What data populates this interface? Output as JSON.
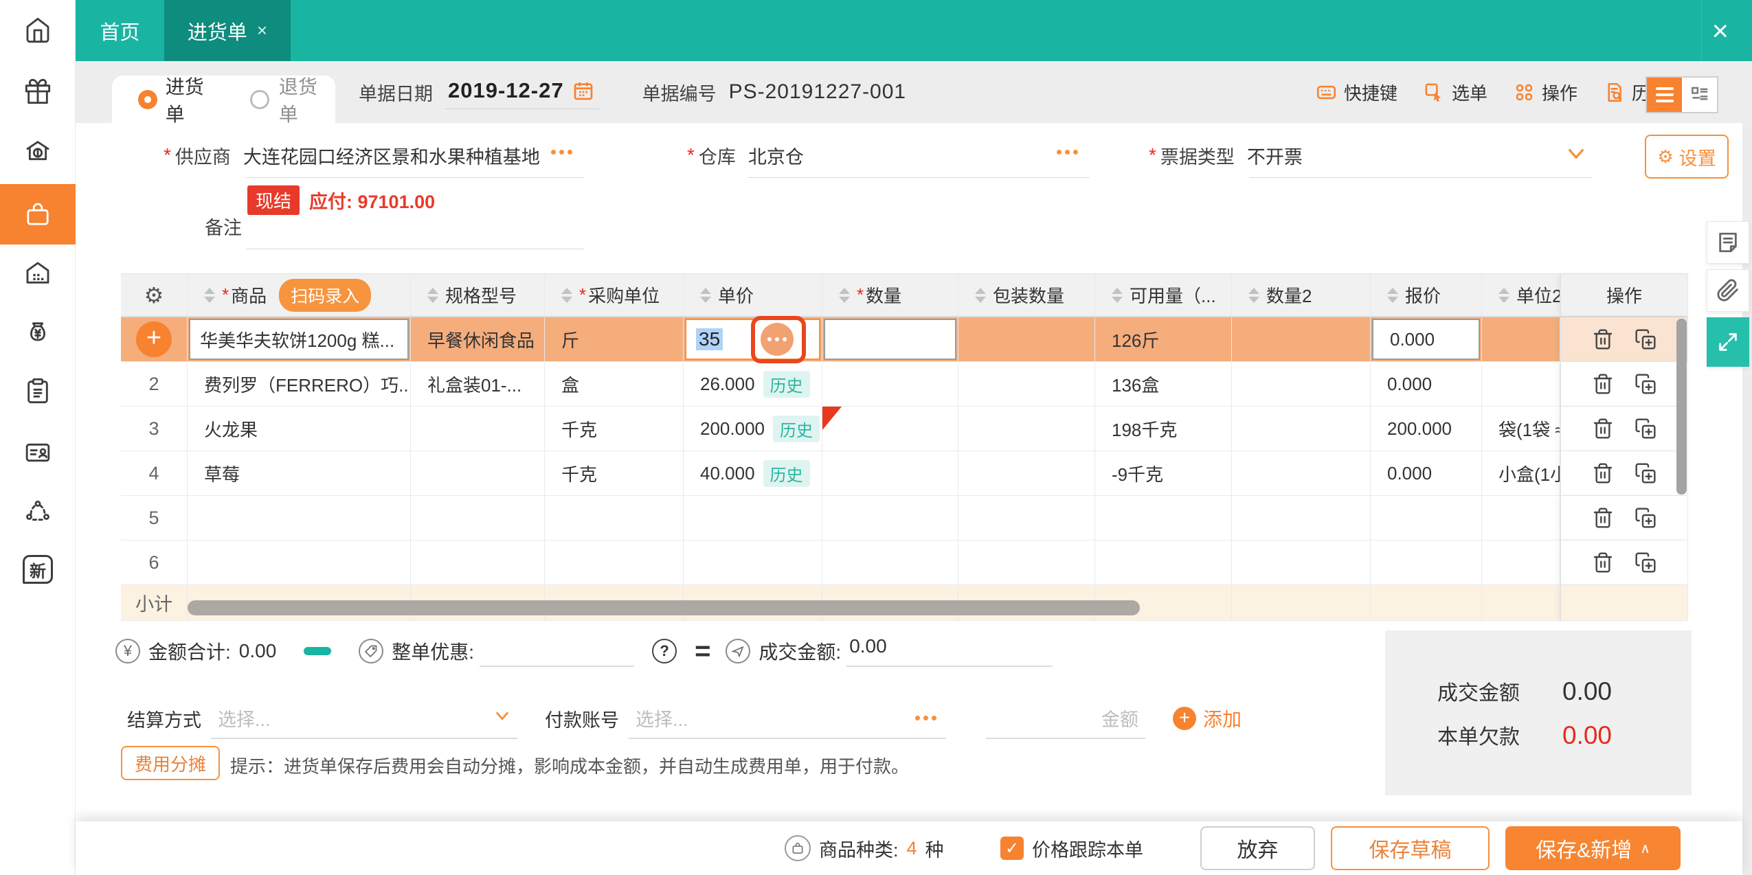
{
  "topbar": {
    "home_tab": "首页",
    "active_tab": "进货单",
    "close_tab": "×",
    "close_window": "×"
  },
  "sidebar": {
    "items": [
      "home",
      "gift",
      "sales",
      "purchase",
      "warehouse",
      "funds",
      "orders",
      "contacts",
      "share",
      "new"
    ],
    "new_label": "新"
  },
  "doc": {
    "type_purchase": "进货单",
    "type_return": "退货单",
    "date_label": "单据日期",
    "date_value": "2019-12-27",
    "number_label": "单据编号",
    "number_value": "PS-20191227-001"
  },
  "tools": {
    "shortcut": "快捷键",
    "pick": "选单",
    "operate": "操作",
    "history": "历史单据"
  },
  "form": {
    "required_mark": "*",
    "supplier_label": "供应商",
    "supplier_value": "大连花园口经济区景和水果种植基地",
    "settle_badge": "现结",
    "payable_text": "应付: 97101.00",
    "remark_label": "备注",
    "warehouse_label": "仓库",
    "warehouse_value": "北京仓",
    "bill_label": "票据类型",
    "bill_value": "不开票",
    "settings_label": "设置"
  },
  "table": {
    "scan_button": "扫码录入",
    "headers": [
      "",
      "商品",
      "规格型号",
      "采购单位",
      "单价",
      "数量",
      "包装数量",
      "可用量（...",
      "数量2",
      "报价",
      "单位2",
      "操作"
    ],
    "required_cols": [
      1,
      3,
      5
    ],
    "history_badge": "历史",
    "rows": [
      {
        "index": "+",
        "selected": true,
        "product": "华美华夫软饼1200g 糕...",
        "spec": "早餐休闲食品",
        "unit": "斤",
        "price": "35",
        "qty": "",
        "pack": "",
        "available": "126斤",
        "qty2": "",
        "quote": "0.000",
        "unit2": ""
      },
      {
        "index": "2",
        "product": "费列罗（FERRERO）巧...",
        "spec": "礼盒装01-...",
        "unit": "盒",
        "price": "26.000",
        "history": true,
        "available": "136盒",
        "quote": "0.000",
        "unit2": ""
      },
      {
        "index": "3",
        "product": "火龙果",
        "spec": "",
        "unit": "千克",
        "price": "200.000",
        "history": true,
        "flag": true,
        "available": "198千克",
        "quote": "200.000",
        "unit2": "袋(1袋 ≈"
      },
      {
        "index": "4",
        "product": "草莓",
        "spec": "",
        "unit": "千克",
        "price": "40.000",
        "history": true,
        "available": "-9千克",
        "quote": "0.000",
        "unit2": "小盒(1小"
      },
      {
        "index": "5"
      },
      {
        "index": "6"
      },
      {
        "index": "小计",
        "subtotal": true
      }
    ]
  },
  "totals": {
    "sum_label": "金额合计:",
    "sum_value": "0.00",
    "discount_label": "整单优惠:",
    "deal_label": "成交金额:",
    "deal_value": "0.00"
  },
  "payment": {
    "method_label": "结算方式",
    "method_placeholder": "选择...",
    "account_label": "付款账号",
    "account_placeholder": "选择...",
    "amount_placeholder": "金额",
    "add_label": "添加"
  },
  "fee": {
    "button_label": "费用分摊",
    "tip": "提示：进货单保存后费用会自动分摊，影响成本金额，并自动生成费用单，用于付款。"
  },
  "summary": {
    "deal_label": "成交金额",
    "deal_value": "0.00",
    "debt_label": "本单欠款",
    "debt_value": "0.00"
  },
  "footer": {
    "category_label": "商品种类:",
    "category_count": "4",
    "category_unit": "种",
    "price_track": "价格跟踪本单",
    "cancel": "放弃",
    "save_draft": "保存草稿",
    "save_new": "保存&新增"
  },
  "colors": {
    "accent": "#F7822F",
    "teal": "#1AB4A2",
    "tab_active": "#0E8C7D",
    "danger": "#E8291D",
    "row_highlight": "#F5AD7C",
    "history_bg": "#DFF4F0",
    "history_text": "#2AB5A2"
  }
}
